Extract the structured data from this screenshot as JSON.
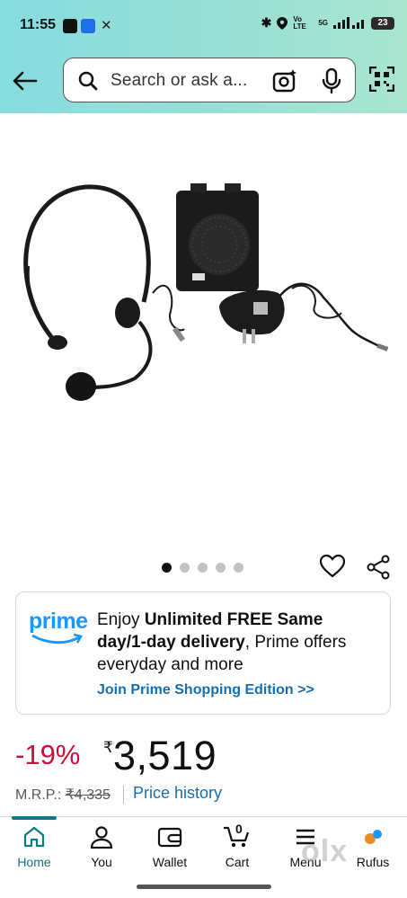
{
  "status_bar": {
    "time": "11:55",
    "network": "Vo LTE",
    "signal": "5G",
    "battery": "23"
  },
  "search": {
    "placeholder": "Search or ask a..."
  },
  "carousel": {
    "total_images": 5,
    "active_index": 0
  },
  "prime": {
    "logo": "prime",
    "text_prefix": "Enjoy ",
    "text_bold": "Unlimited FREE Same day/1-day delivery",
    "text_suffix": ", Prime offers everyday and more",
    "link": "Join Prime Shopping Edition >>"
  },
  "price": {
    "discount": "-19%",
    "currency": "₹",
    "amount": "3,519",
    "mrp_label": "M.R.P.:",
    "mrp_value": "₹4,335",
    "history_link": "Price history"
  },
  "bottom_nav": [
    {
      "label": "Home",
      "icon": "home-icon",
      "active": true
    },
    {
      "label": "You",
      "icon": "user-icon",
      "active": false
    },
    {
      "label": "Wallet",
      "icon": "wallet-icon",
      "active": false
    },
    {
      "label": "Cart",
      "icon": "cart-icon",
      "active": false,
      "badge": "0"
    },
    {
      "label": "Menu",
      "icon": "menu-icon",
      "active": false
    },
    {
      "label": "Rufus",
      "icon": "rufus-icon",
      "active": false
    }
  ],
  "watermark": "olx",
  "colors": {
    "header_gradient_start": "#86dce0",
    "header_gradient_end": "#a9e5cf",
    "discount": "#cc0c39",
    "link": "#146eb4",
    "active_nav": "#0a7b83",
    "prime_blue": "#1a98ff"
  }
}
